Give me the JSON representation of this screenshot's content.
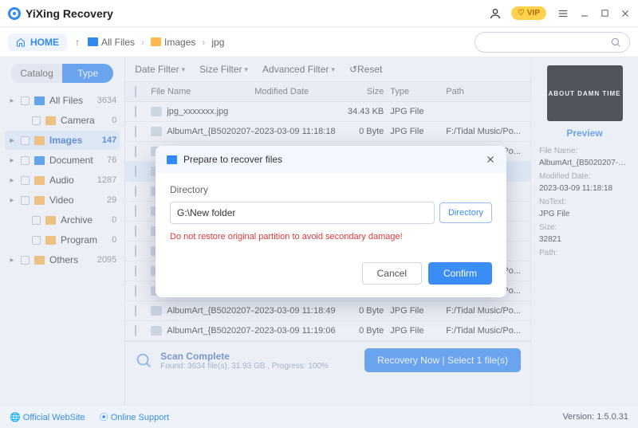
{
  "brand": "YiXing Recovery",
  "vip_label": "VIP",
  "home_label": "HOME",
  "breadcrumb": {
    "all": "All Files",
    "images": "Images",
    "jpg": "jpg"
  },
  "search_placeholder": "",
  "segments": {
    "catalog": "Catalog",
    "type": "Type"
  },
  "sidebar": [
    {
      "label": "All Files",
      "count": "3634",
      "cls": "",
      "indent": 0,
      "caret": "▸",
      "clr": "blue"
    },
    {
      "label": "Camera",
      "count": "0",
      "cls": "",
      "indent": 1,
      "caret": "",
      "clr": ""
    },
    {
      "label": "Images",
      "count": "147",
      "cls": "selected",
      "indent": 0,
      "caret": "▸",
      "clr": ""
    },
    {
      "label": "Document",
      "count": "76",
      "cls": "",
      "indent": 0,
      "caret": "▸",
      "clr": "blue"
    },
    {
      "label": "Audio",
      "count": "1287",
      "cls": "",
      "indent": 0,
      "caret": "▸",
      "clr": ""
    },
    {
      "label": "Video",
      "count": "29",
      "cls": "",
      "indent": 0,
      "caret": "▸",
      "clr": ""
    },
    {
      "label": "Archive",
      "count": "0",
      "cls": "",
      "indent": 1,
      "caret": "",
      "clr": ""
    },
    {
      "label": "Program",
      "count": "0",
      "cls": "",
      "indent": 1,
      "caret": "",
      "clr": ""
    },
    {
      "label": "Others",
      "count": "2095",
      "cls": "",
      "indent": 0,
      "caret": "▸",
      "clr": ""
    }
  ],
  "filters": {
    "date": "Date Filter",
    "size": "Size Filter",
    "advanced": "Advanced Filter",
    "reset": "↺Reset"
  },
  "columns": {
    "name": "File Name",
    "date": "Modified Date",
    "size": "Size",
    "type": "Type",
    "path": "Path"
  },
  "rows": [
    {
      "name": "jpg_xxxxxxx.jpg",
      "date": "",
      "size": "34.43 KB",
      "type": "JPG File",
      "path": "",
      "sel": false
    },
    {
      "name": "AlbumArt_{B5020207-4...",
      "date": "2023-03-09 11:18:18",
      "size": "0 Byte",
      "type": "JPG File",
      "path": "F:/Tidal Music/Po...",
      "sel": false
    },
    {
      "name": "AlbumArt_{B5020207-4...",
      "date": "2023-03-09 11:18:18",
      "size": "0 Byte",
      "type": "JPG File",
      "path": "F:/Tidal Music/Po...",
      "sel": false
    },
    {
      "name": "",
      "date": "",
      "size": "",
      "type": "",
      "path": "Music/Po...",
      "sel": true
    },
    {
      "name": "",
      "date": "",
      "size": "",
      "type": "",
      "path": "usic/Po...",
      "sel": false
    },
    {
      "name": "",
      "date": "",
      "size": "",
      "type": "",
      "path": "usic/Po...",
      "sel": false
    },
    {
      "name": "",
      "date": "",
      "size": "",
      "type": "",
      "path": "usic/Po...",
      "sel": false
    },
    {
      "name": "",
      "date": "",
      "size": "",
      "type": "",
      "path": "usic/Po...",
      "sel": false
    },
    {
      "name": "AlbumArt_{B5020207-4...",
      "date": "2023-03-09 11:18:40",
      "size": "0 Byte",
      "type": "JPG File",
      "path": "F:/Tidal Music/Po...",
      "sel": false
    },
    {
      "name": "AlbumArt_{B5020207-4...",
      "date": "2023-03-09 11:18:49",
      "size": "0 Byte",
      "type": "JPG File",
      "path": "F:/Tidal Music/Po...",
      "sel": false
    },
    {
      "name": "AlbumArt_{B5020207-4...",
      "date": "2023-03-09 11:18:49",
      "size": "0 Byte",
      "type": "JPG File",
      "path": "F:/Tidal Music/Po...",
      "sel": false
    },
    {
      "name": "AlbumArt_{B5020207-4...",
      "date": "2023-03-09 11:19:06",
      "size": "0 Byte",
      "type": "JPG File",
      "path": "F:/Tidal Music/Po...",
      "sel": false
    }
  ],
  "preview": {
    "thumb_text": "ABOUT DAMN TIME",
    "link": "Preview",
    "labels": {
      "name": "File Name:",
      "date": "Modified Date:",
      "notext": "NoText:",
      "size": "Size:",
      "path": "Path:"
    },
    "values": {
      "name": "AlbumArt_{B5020207-474E-47...",
      "date": "2023-03-09 11:18:18",
      "type": "JPG File",
      "size": "32821",
      "path": ""
    }
  },
  "scan": {
    "title": "Scan Complete",
    "sub": "Found: 3634 file(s), 31.93 GB , Progress: 100%"
  },
  "recovery_label": "Recovery Now | Select 1 file(s)",
  "footer": {
    "site": "Official WebSite",
    "support": "Online Support",
    "version": "Version: 1.5.0.31"
  },
  "modal": {
    "title": "Prepare to recover files",
    "dir_label": "Directory",
    "dir_value": "G:\\New folder",
    "dir_button": "Directory",
    "warning": "Do not restore original partition to avoid secondary damage!",
    "cancel": "Cancel",
    "confirm": "Confirm"
  }
}
